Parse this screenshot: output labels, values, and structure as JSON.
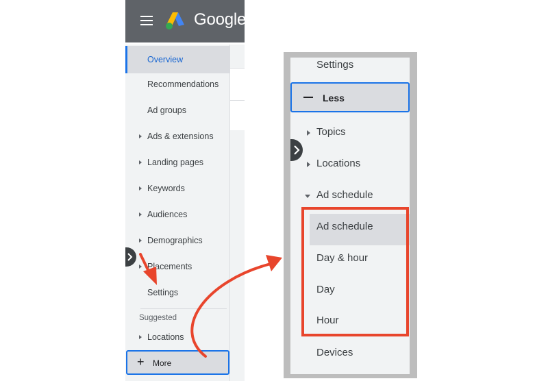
{
  "left_panel": {
    "brand": "Google",
    "nav_items": [
      {
        "label": "Overview",
        "has_caret": false,
        "active": true
      },
      {
        "label": "Recommendations",
        "has_caret": false
      },
      {
        "label": "Ad groups",
        "has_caret": false
      },
      {
        "label": "Ads & extensions",
        "has_caret": true
      },
      {
        "label": "Landing pages",
        "has_caret": true
      },
      {
        "label": "Keywords",
        "has_caret": true
      },
      {
        "label": "Audiences",
        "has_caret": true
      },
      {
        "label": "Demographics",
        "has_caret": true
      },
      {
        "label": "Placements",
        "has_caret": true
      },
      {
        "label": "Settings",
        "has_caret": false
      }
    ],
    "suggested_heading": "Suggested",
    "suggested_items": [
      {
        "label": "Locations",
        "has_caret": true
      }
    ],
    "more_button": {
      "icon": "+",
      "label": "More"
    }
  },
  "right_panel": {
    "settings_label": "Settings",
    "less_button": {
      "label": "Less"
    },
    "items": [
      {
        "label": "Topics",
        "caret": "right"
      },
      {
        "label": "Locations",
        "caret": "right"
      },
      {
        "label": "Ad schedule",
        "caret": "down"
      }
    ],
    "sub_items": [
      {
        "label": "Ad schedule",
        "selected": true
      },
      {
        "label": "Day & hour"
      },
      {
        "label": "Day"
      },
      {
        "label": "Hour"
      }
    ],
    "bottom_item": "Devices"
  },
  "colors": {
    "accent_blue": "#1a73e8",
    "annotation_red": "#e8452c",
    "topbar_gray": "#5f6368",
    "nav_bg": "#f1f3f4"
  },
  "icons": [
    "hamburger-menu-icon",
    "google-ads-logo",
    "chevron-right-icon",
    "caret-right-icon",
    "caret-down-icon",
    "plus-icon",
    "minus-icon"
  ]
}
